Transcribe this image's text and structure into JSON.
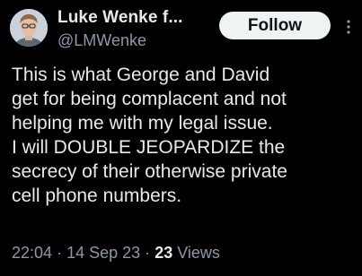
{
  "author": {
    "display_name": "Luke Wenke f...",
    "handle": "@LMWenke",
    "avatar_icon": "user-avatar"
  },
  "follow_button": {
    "label": "Follow"
  },
  "more_menu": {
    "icon": "more-vertical-icon"
  },
  "tweet": {
    "lines": [
      "This is what George and David",
      "get for being complacent and not",
      "helping me with my legal issue.",
      "I will DOUBLE JEOPARDIZE the",
      "secrecy of their otherwise private",
      "cell phone numbers."
    ]
  },
  "meta": {
    "time": "22:04",
    "separator": "·",
    "date": "14 Sep 23",
    "views_count": "23",
    "views_label": "Views"
  },
  "colors": {
    "background": "#000000",
    "primary_text": "#e7e9ea",
    "secondary_text": "#8b98a5",
    "follow_button_bg": "#eff3f4"
  }
}
